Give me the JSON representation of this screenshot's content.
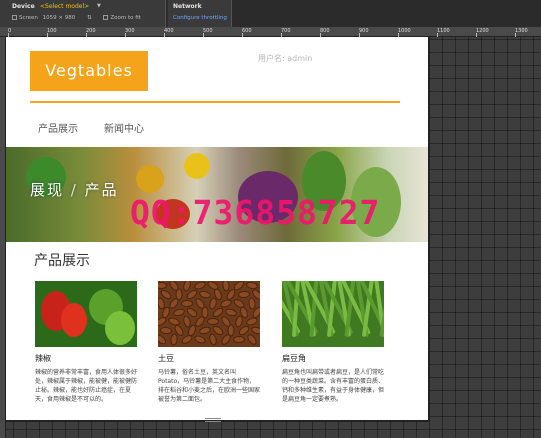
{
  "devtools": {
    "device_tab": "Device",
    "device_select": "<Select model>",
    "screen_label": "Screen",
    "screen_width": "1059",
    "screen_height": "980",
    "zoom_label": "Zoom to fit",
    "network_tab": "Network",
    "network_link": "Configure throttling",
    "ruler_labels": [
      "0",
      "100",
      "200",
      "300",
      "400",
      "500",
      "600",
      "700",
      "800",
      "900",
      "1000",
      "1100",
      "1200",
      "1300"
    ]
  },
  "page": {
    "logo": "Vegtables",
    "user_label": "用户名: admin",
    "nav": [
      "产品展示",
      "新闻中心"
    ],
    "banner_text": "展现",
    "banner_sep": "/",
    "banner_text2": "产品",
    "watermark": "QQ:736858727",
    "section_title": "产品展示",
    "products": [
      {
        "name": "辣椒",
        "desc": "辣椒的营养非常丰富，食用人体很多好处，辣椒属于辣椒，能被健，能被健防止秘。辣椒，能也好防止癌症，在夏天，食用辣椒是不可以的。"
      },
      {
        "name": "土豆",
        "desc": "马铃薯，俗名土豆，英文名叫Potato，马铃薯是第二大主食作物，排在稻谷和小麦之后，在欧洲一些国家被誉为第二面包。"
      },
      {
        "name": "扁豆角",
        "desc": "扁豆角也叫扁带或者扁豆，是人们常吃的一种豆类蔬菜。含有丰富的蛋白质、钙和多种维生素，有益于身体健康，但是扁豆角一定要煮熟。"
      }
    ]
  },
  "colors": {
    "accent": "#f4a31a",
    "watermark": "#f0156d"
  }
}
